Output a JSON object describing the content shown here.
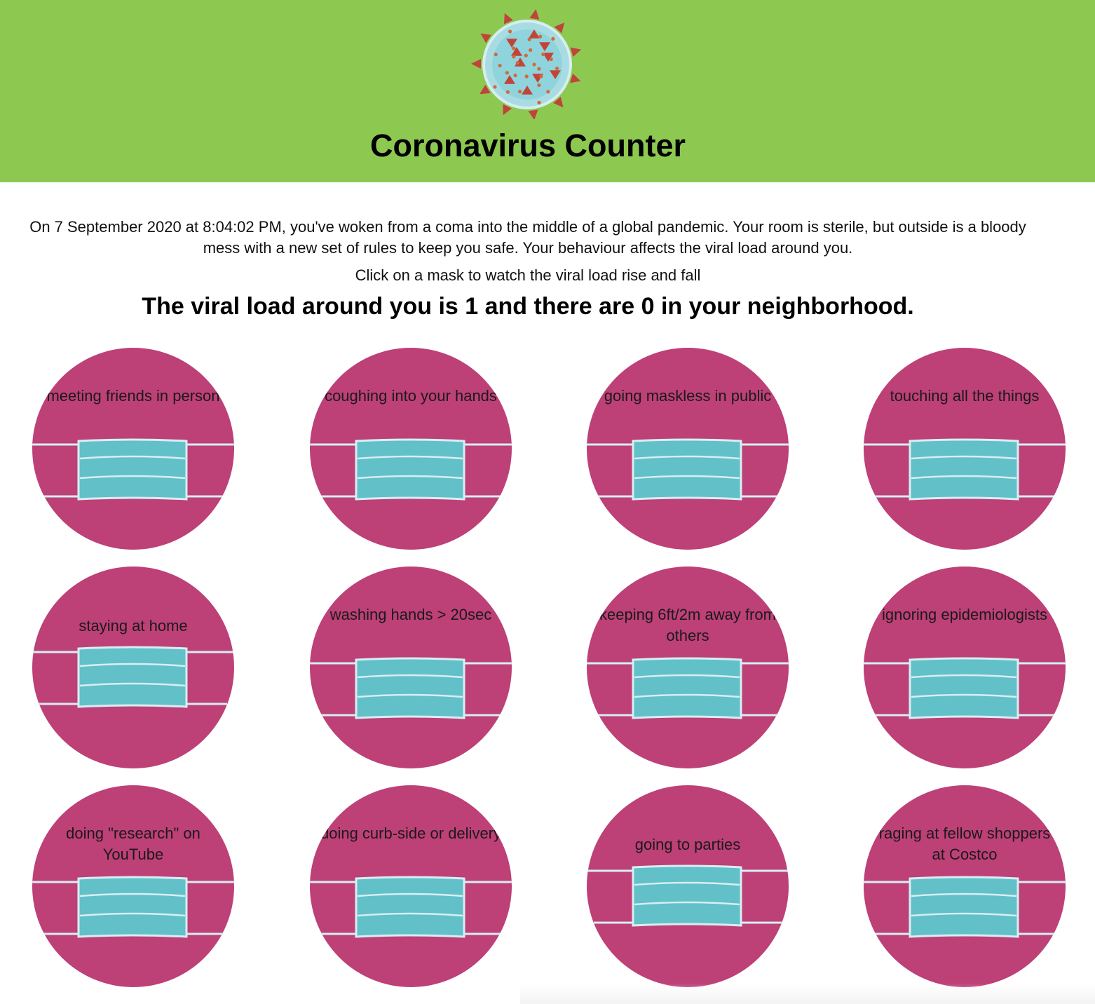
{
  "header": {
    "logo_icon": "coronavirus-icon",
    "title": "Coronavirus Counter",
    "background_color": "#8dc951"
  },
  "intro": {
    "text": "On 7 September 2020 at 8:04:02 PM, you've woken from a coma into the middle of a global pandemic. Your room is sterile, but outside is a bloody mess with a new set of rules to keep you safe. Your behaviour affects the viral load around you."
  },
  "instruction": "Click on a mask to watch the viral load rise and fall",
  "status": {
    "text": "The viral load around you is 1 and there are 0 in your neighborhood.",
    "viral_load": 1,
    "neighborhood_count": 0
  },
  "colors": {
    "circle": "#bd4077",
    "mask": "#62c0c9",
    "mask_lines": "#d8eef2"
  },
  "masks": [
    {
      "label": "meeting friends in person"
    },
    {
      "label": "coughing into your hands"
    },
    {
      "label": "going maskless in public"
    },
    {
      "label": "touching all the things"
    },
    {
      "label": "staying at home"
    },
    {
      "label": "washing hands > 20sec"
    },
    {
      "label": "keeping 6ft/2m away from others"
    },
    {
      "label": "ignoring epidemiologists"
    },
    {
      "label": "doing \"research\" on YouTube"
    },
    {
      "label": "doing curb-side or delivery"
    },
    {
      "label": "going to parties"
    },
    {
      "label": "raging at fellow shoppers at Costco"
    }
  ]
}
